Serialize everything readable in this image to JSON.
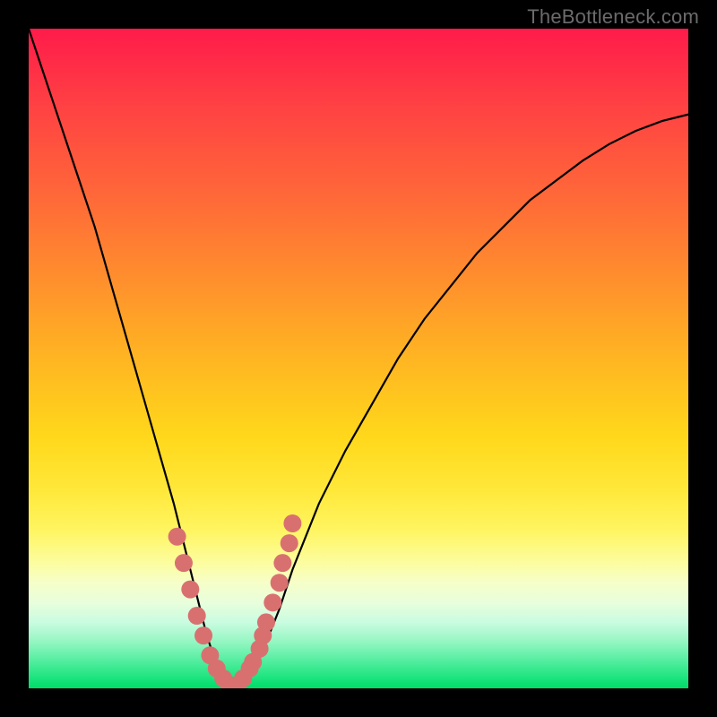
{
  "watermark": "TheBottleneck.com",
  "colors": {
    "frame": "#000000",
    "curve": "#000000",
    "marker": "#d97070",
    "gradient_top": "#ff1b4a",
    "gradient_bottom": "#00dc67"
  },
  "chart_data": {
    "type": "line",
    "title": "",
    "xlabel": "",
    "ylabel": "",
    "xlim": [
      0,
      100
    ],
    "ylim": [
      0,
      100
    ],
    "grid": false,
    "legend": false,
    "annotations": [],
    "series": [
      {
        "name": "bottleneck-curve",
        "x": [
          0,
          2,
          4,
          6,
          8,
          10,
          12,
          14,
          16,
          18,
          20,
          22,
          24,
          26,
          27,
          28,
          29,
          30,
          31,
          32,
          33,
          34,
          36,
          38,
          40,
          44,
          48,
          52,
          56,
          60,
          64,
          68,
          72,
          76,
          80,
          84,
          88,
          92,
          96,
          100
        ],
        "y": [
          100,
          94,
          88,
          82,
          76,
          70,
          63,
          56,
          49,
          42,
          35,
          28,
          20,
          12,
          8,
          5,
          3,
          1,
          0,
          0,
          1,
          3,
          7,
          12,
          18,
          28,
          36,
          43,
          50,
          56,
          61,
          66,
          70,
          74,
          77,
          80,
          82.5,
          84.5,
          86,
          87
        ]
      }
    ],
    "markers": {
      "name": "highlighted-points",
      "description": "salmon bead markers near the valley region",
      "x": [
        22.5,
        23.5,
        24.5,
        25.5,
        26.5,
        27.5,
        28.5,
        29.5,
        30.5,
        31.5,
        32.5,
        33.5,
        34.0,
        35.0,
        35.5,
        36.0,
        37.0,
        38.0,
        38.5,
        39.5,
        40.0
      ],
      "y": [
        23,
        19,
        15,
        11,
        8,
        5,
        3,
        1.5,
        0.5,
        0.5,
        1.5,
        3,
        4,
        6,
        8,
        10,
        13,
        16,
        19,
        22,
        25
      ]
    }
  }
}
